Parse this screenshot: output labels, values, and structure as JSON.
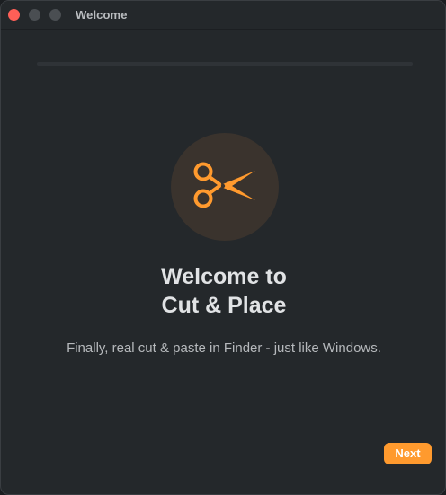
{
  "window": {
    "title": "Welcome"
  },
  "progress": {
    "value": 0
  },
  "hero": {
    "icon": "scissors-icon",
    "accent_color": "#ff9a2e"
  },
  "content": {
    "heading_line1": "Welcome to",
    "heading_line2": "Cut & Place",
    "subtitle": "Finally, real cut & paste in Finder - just like Windows."
  },
  "footer": {
    "next_label": "Next"
  }
}
